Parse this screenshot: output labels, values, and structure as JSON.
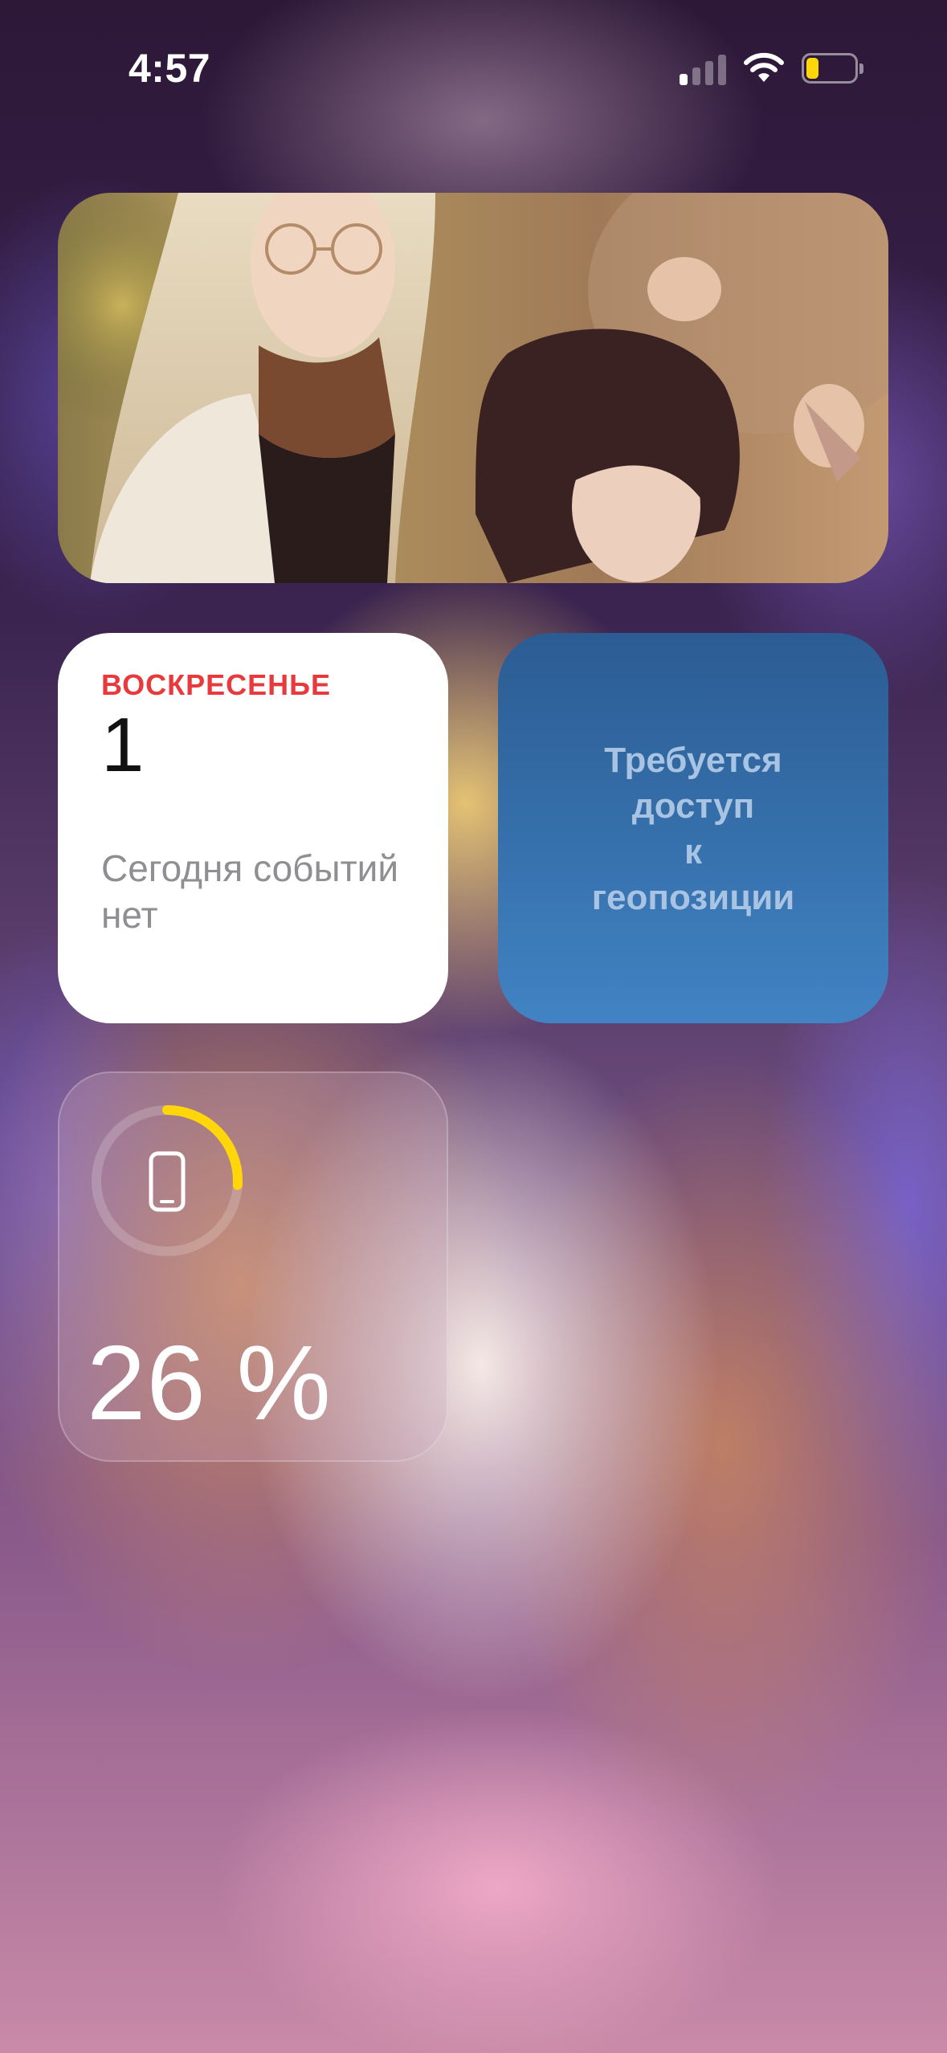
{
  "status_bar": {
    "time": "4:57",
    "signal_icon": "cellular-signal-icon",
    "wifi_icon": "wifi-icon",
    "battery_icon": "battery-icon",
    "battery_level": 0.26,
    "battery_color": "#ffd60a"
  },
  "photo_widget": {
    "image": "photo-icon"
  },
  "calendar_widget": {
    "day_name": "ВОСКРЕСЕНЬЕ",
    "date": "1",
    "no_events": "Сегодня событий нет",
    "day_color": "#e8393c"
  },
  "weather_widget": {
    "message": "Требуется\nдоступ\nк\nгеопозиции",
    "text_color": "#a9c3e2"
  },
  "battery_widget": {
    "device_icon": "iphone-icon",
    "percent_label": "26 %",
    "level": 0.26,
    "ring_color": "#ffd60a"
  }
}
